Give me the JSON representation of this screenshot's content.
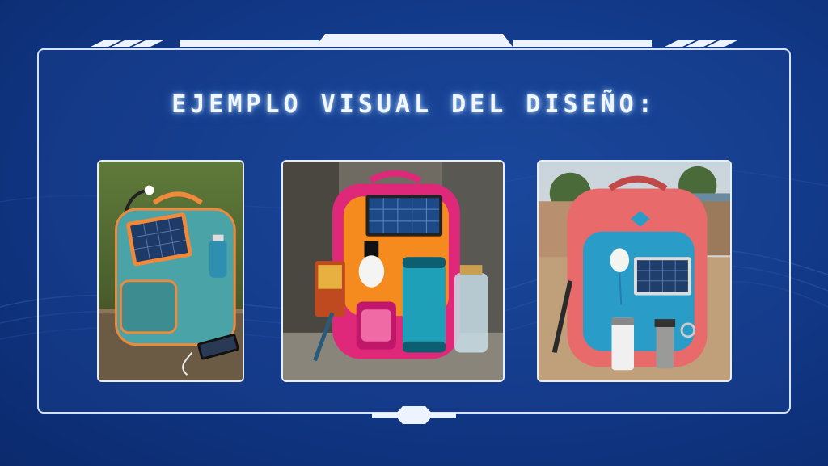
{
  "slide": {
    "title": "EJEMPLO VISUAL DEL DISEÑO:"
  },
  "images": [
    {
      "name": "backpack-teal-solar-photo"
    },
    {
      "name": "backpack-orange-pink-solar-photo"
    },
    {
      "name": "backpack-coral-blue-solar-photo"
    }
  ],
  "colors": {
    "background": "#123a8a",
    "frame": "#ebf5ff",
    "title": "#f2f6ff"
  }
}
